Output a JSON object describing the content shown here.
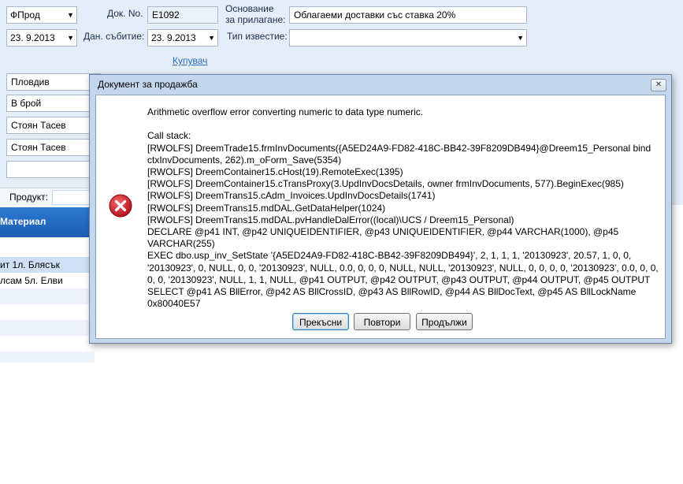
{
  "form": {
    "company": "ФПрод",
    "doc_no_label": "Док. No.",
    "doc_no": "E1092",
    "basis_label_line1": "Основание",
    "basis_label_line2": "за прилагане:",
    "basis_value": "Облагаеми доставки със ставка 20%",
    "date1": "23. 9.2013",
    "tax_date_label": "Дан. събитие:",
    "tax_date": "23. 9.2013",
    "notice_type_label": "Тип известие:",
    "notice_type_value": "",
    "buyer_link": "Купувач",
    "city": "Пловдив",
    "payment": "В брой",
    "person1": "Стоян Тасев",
    "person2": "Стоян Тасев",
    "blank_field": "",
    "product_label": "Продукт:",
    "material_header": "Материал",
    "rows": [
      {
        "text": "ит 1л. Блясък"
      },
      {
        "text": "лсам 5л. Елви"
      },
      {
        "text": ""
      },
      {
        "text": ""
      },
      {
        "text": ""
      },
      {
        "text": ""
      }
    ]
  },
  "dialog": {
    "title": "Документ за продажба",
    "close_glyph": "✕",
    "message": "Arithmetic overflow error converting numeric to data type numeric.\n\nCall stack:\n[RWOLFS] DreemTrade15.frmInvDocuments({A5ED24A9-FD82-418C-BB42-39F8209DB494}@Dreem15_Personal bind ctxInvDocuments, 262).m_oForm_Save(5354)\n[RWOLFS] DreemContainer15.cHost(19).RemoteExec(1395)\n[RWOLFS] DreemContainer15.cTransProxy(3.UpdInvDocsDetails, owner frmInvDocuments, 577).BeginExec(985)\n[RWOLFS] DreemTrans15.cAdm_Invoices.UpdInvDocsDetails(1741)\n[RWOLFS] DreemTrans15.mdDAL.GetDataHelper(1024)\n[RWOLFS] DreemTrans15.mdDAL.pvHandleDalError((local)\\UCS / Dreem15_Personal)\nDECLARE @p41 INT, @p42 UNIQUEIDENTIFIER, @p43 UNIQUEIDENTIFIER, @p44 VARCHAR(1000), @p45 VARCHAR(255)\nEXEC dbo.usp_inv_SetState '{A5ED24A9-FD82-418C-BB42-39F8209DB494}', 2, 1, 1, 1, '20130923', 20.57, 1, 0, 0, '20130923', 0, NULL, 0, 0, '20130923', NULL, 0.0, 0, 0, 0, NULL, NULL, '20130923', NULL, 0, 0, 0, 0, '20130923', 0.0, 0, 0, 0, 0, '20130923', NULL, 1, 1, NULL, @p41 OUTPUT, @p42 OUTPUT, @p43 OUTPUT, @p44 OUTPUT, @p45 OUTPUT\nSELECT @p41 AS BllError, @p42 AS BllCrossID, @p43 AS BllRowID, @p44 AS BllDocText, @p45 AS BllLockName\n0x80040E57",
    "buttons": {
      "abort": "Прекъсни",
      "retry": "Повтори",
      "continue": "Продължи"
    }
  },
  "colors": {
    "header_band": "#1c5eb4",
    "form_bg": "#e4edf8",
    "error_icon": "#c8102e"
  },
  "icons": {
    "error": "error-icon",
    "dropdown": "chevron-down-icon",
    "close": "close-icon"
  }
}
